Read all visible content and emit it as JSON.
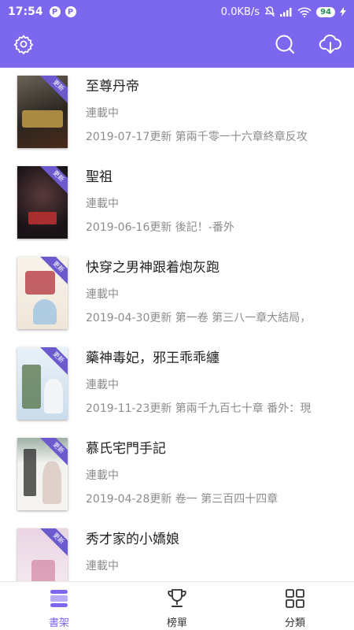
{
  "status_bar": {
    "time": "17:54",
    "notif_1": "P",
    "notif_2": "P",
    "net_speed": "0.0KB/s",
    "battery": "94"
  },
  "app_bar": {
    "settings_icon": "gear-icon",
    "search_icon": "search-icon",
    "download_icon": "cloud-download-icon"
  },
  "books": [
    {
      "title": "至尊丹帝",
      "status": "連載中",
      "update": "2019-07-17更新 第兩千零一十六章終章反攻",
      "badge": "更新",
      "cover_color": "#3a3530"
    },
    {
      "title": "聖祖",
      "status": "連載中",
      "update": "2019-06-16更新 後記！-番外",
      "badge": "更新",
      "cover_color": "#1e1a22"
    },
    {
      "title": "快穿之男神跟着炮灰跑",
      "status": "連載中",
      "update": "2019-04-30更新 第一卷 第三八一章大結局，",
      "badge": "更新",
      "cover_color": "#f4eee6"
    },
    {
      "title": "藥神毒妃，邪王乖乖纏",
      "status": "連載中",
      "update": "2019-11-23更新 第兩千九百七十章 番外：現",
      "badge": "更新",
      "cover_color": "#dde8f2"
    },
    {
      "title": "慕氏宅門手記",
      "status": "連載中",
      "update": "2019-04-28更新 卷一 第三百四十四章",
      "badge": "更新",
      "cover_color": "#eef0ea"
    },
    {
      "title": "秀才家的小嬌娘",
      "status": "連載中",
      "update": "",
      "badge": "更新",
      "cover_color": "#f3e6ee"
    }
  ],
  "bottom_nav": {
    "shelf": "書架",
    "ranking": "榜單",
    "category": "分類"
  },
  "colors": {
    "accent": "#7b68ee",
    "ribbon": "#6a5acd",
    "muted_text": "#8c8c8c"
  }
}
